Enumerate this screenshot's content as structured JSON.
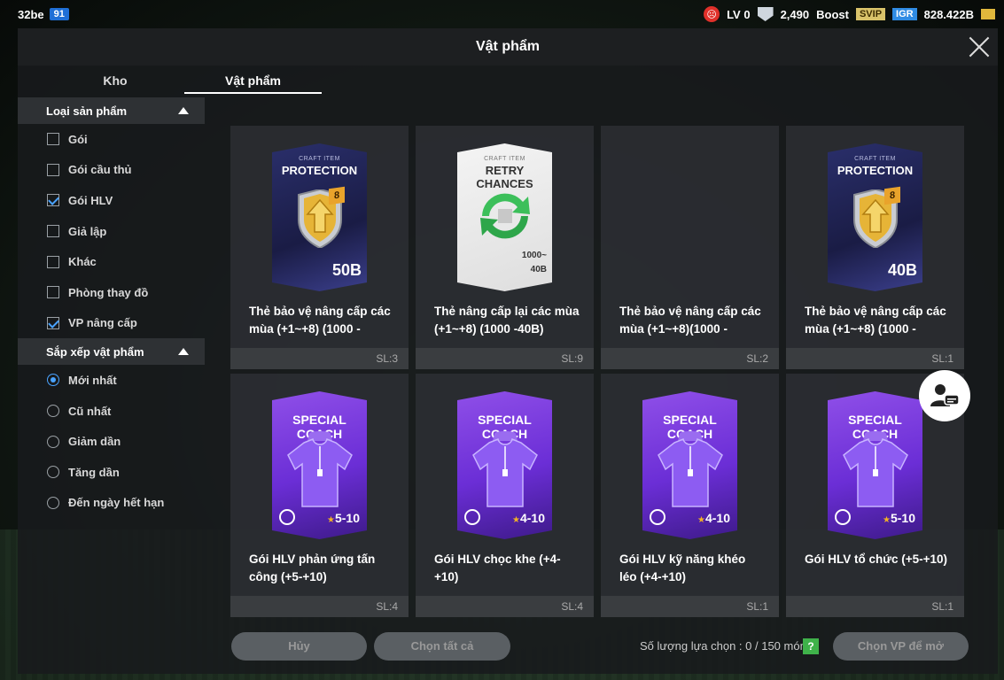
{
  "topbar": {
    "user": "32be",
    "level_badge": "91",
    "lv": "LV 0",
    "points": "2,490",
    "boost": "Boost",
    "svip": "SVIP",
    "igr": "IGR",
    "balance": "828.422B"
  },
  "modal": {
    "title": "Vật phẩm",
    "tabs": [
      {
        "label": "Kho"
      },
      {
        "label": "Vật phẩm"
      }
    ]
  },
  "sidebar": {
    "filter_title": "Loại sản phẩm",
    "filters": [
      {
        "label": "Gói",
        "checked": false
      },
      {
        "label": "Gói cầu thủ",
        "checked": false
      },
      {
        "label": "Gói HLV",
        "checked": true
      },
      {
        "label": "Giả lập",
        "checked": false
      },
      {
        "label": "Khác",
        "checked": false
      },
      {
        "label": "Phòng thay đồ",
        "checked": false
      },
      {
        "label": "VP nâng cấp",
        "checked": true
      }
    ],
    "sort_title": "Sắp xếp vật phẩm",
    "sorts": [
      {
        "label": "Mới nhất",
        "selected": true
      },
      {
        "label": "Cũ nhất",
        "selected": false
      },
      {
        "label": "Giảm dần",
        "selected": false
      },
      {
        "label": "Tăng dần",
        "selected": false
      },
      {
        "label": "Đến ngày hết hạn",
        "selected": false
      }
    ]
  },
  "items": [
    {
      "kind": "protection",
      "name": "Thẻ bảo vệ nâng cấp các mùa (+1~+8) (1000 -",
      "qty": "SL:3",
      "card_sub": "CRAFT ITEM",
      "card_title": "PROTECTION",
      "max": "50B",
      "level": "8"
    },
    {
      "kind": "retry",
      "name": "Thẻ nâng cấp lại các mùa (+1~+8) (1000 -40B)",
      "qty": "SL:9",
      "card_sub": "CRAFT ITEM",
      "card_title": "RETRY CHANCES",
      "max": "1000~\n40B"
    },
    {
      "kind": "blank",
      "name": "Thẻ bảo vệ nâng cấp các mùa (+1~+8)(1000 -",
      "qty": "SL:2"
    },
    {
      "kind": "protection",
      "name": "Thẻ bảo vệ nâng cấp các mùa (+1~+8) (1000 -",
      "qty": "SL:1",
      "card_sub": "CRAFT ITEM",
      "card_title": "PROTECTION",
      "max": "40B",
      "level": "8"
    },
    {
      "kind": "coach",
      "name": "Gói HLV phản ứng tấn công (+5-+10)",
      "qty": "SL:4",
      "card_title": "SPECIAL COACH",
      "range": "5-10"
    },
    {
      "kind": "coach",
      "name": "Gói HLV chọc khe (+4-+10)",
      "qty": "SL:4",
      "card_title": "SPECIAL COACH",
      "range": "4-10"
    },
    {
      "kind": "coach",
      "name": "Gói HLV kỹ năng khéo léo (+4-+10)",
      "qty": "SL:1",
      "card_title": "SPECIAL COACH",
      "range": "4-10"
    },
    {
      "kind": "coach",
      "name": "Gói HLV tổ chức (+5-+10)",
      "qty": "SL:1",
      "card_title": "SPECIAL COACH",
      "range": "5-10"
    }
  ],
  "footer": {
    "cancel": "Hủy",
    "select_all": "Chọn tất cả",
    "selection_count": "Số lượng lựa chọn : 0 / 150 món",
    "help": "?",
    "open": "Chọn VP để mở"
  }
}
